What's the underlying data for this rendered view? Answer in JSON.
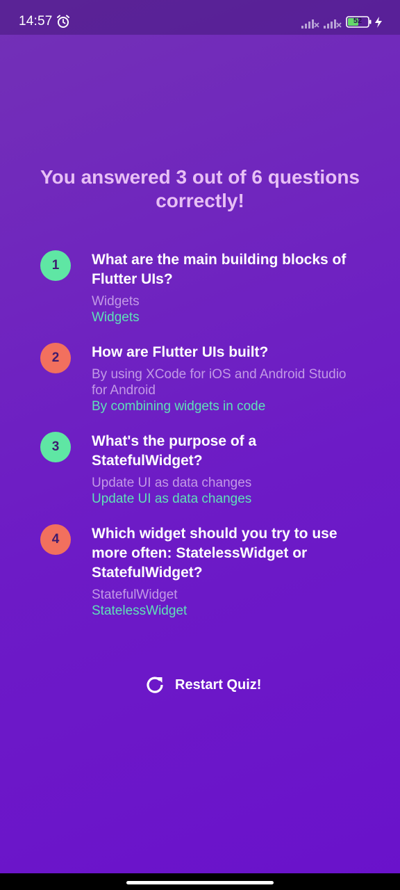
{
  "status_bar": {
    "time": "14:57",
    "battery": "52",
    "icons": [
      "alarm-icon",
      "signal-icon",
      "signal-icon",
      "battery-icon",
      "charging-bolt-icon"
    ]
  },
  "result": {
    "title": "You answered 3 out of 6 questions correctly!"
  },
  "summary": [
    {
      "index": "1",
      "question": "What are the main building blocks of Flutter UIs?",
      "user_answer": "Widgets",
      "correct_answer": "Widgets",
      "is_correct": true
    },
    {
      "index": "2",
      "question": "How are Flutter UIs built?",
      "user_answer": "By using XCode for iOS and Android Studio for Android",
      "correct_answer": "By combining widgets in code",
      "is_correct": false
    },
    {
      "index": "3",
      "question": "What's the purpose of a StatefulWidget?",
      "user_answer": "Update UI as data changes",
      "correct_answer": "Update UI as data changes",
      "is_correct": true
    },
    {
      "index": "4",
      "question": "Which widget should you try to use more often: StatelessWidget or StatefulWidget?",
      "user_answer": "StatefulWidget",
      "correct_answer": "StatelessWidget",
      "is_correct": false
    }
  ],
  "restart": {
    "label": "Restart Quiz!",
    "icon": "restart-icon"
  },
  "colors": {
    "background_top": "#7331b6",
    "background_bottom": "#6a12cb",
    "title": "#e7bff5",
    "badge_correct": "#5fe6a4",
    "badge_wrong": "#f2705e",
    "user_answer": "#c29ae6",
    "correct_answer": "#5fe1b8"
  }
}
